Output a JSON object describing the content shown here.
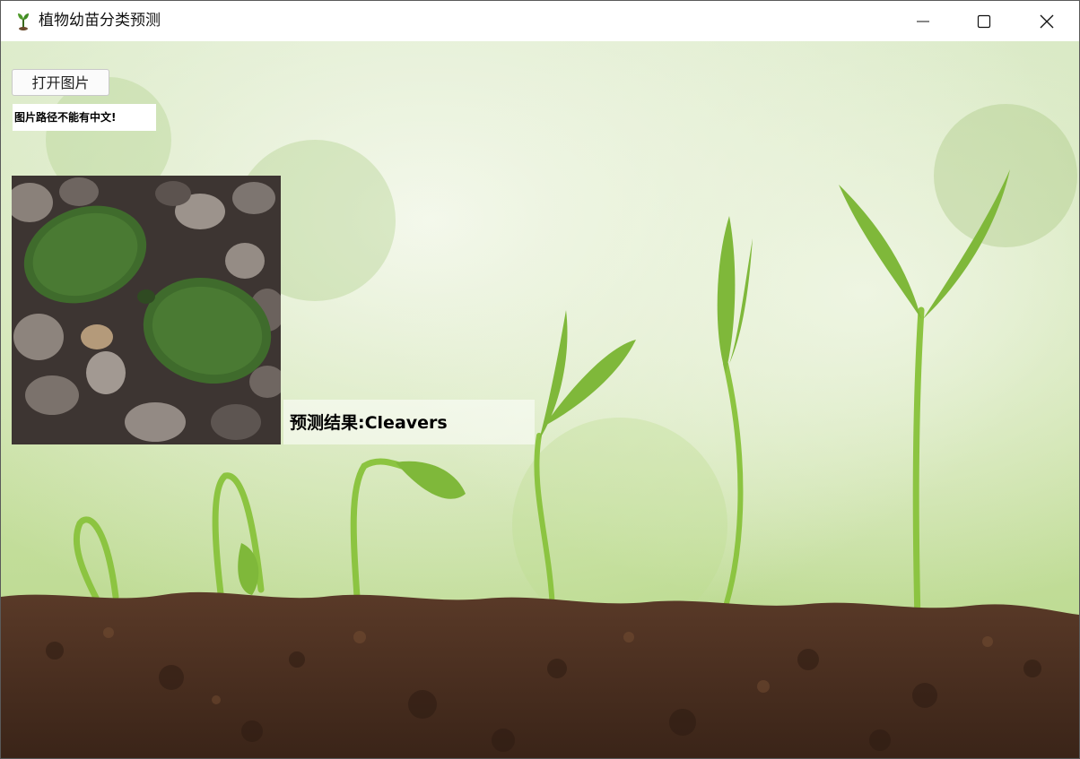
{
  "window": {
    "title": "植物幼苗分类预测",
    "icon": "seedling-app-icon",
    "controls": [
      "minimize-icon",
      "maximize-icon",
      "close-icon"
    ]
  },
  "main": {
    "open_button_label": "打开图片",
    "warning_text": "图片路径不能有中文!",
    "preview_image": "seedling-photo-on-pebbles",
    "result_text": "预测结果:Cleavers"
  },
  "background": {
    "image": "seedling-growth-stages-in-soil",
    "sky_color": "#cfe4b4",
    "soil_color": "#4b3022",
    "stem_color": "#8cc441"
  }
}
